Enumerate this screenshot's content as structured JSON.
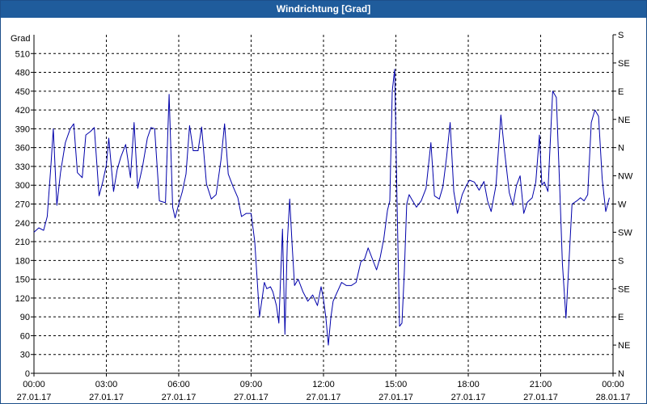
{
  "window": {
    "title": "Windrichtung [Grad]"
  },
  "chart_data": {
    "type": "line",
    "title": "Windrichtung [Grad]",
    "ylabel": "Grad",
    "ylim": [
      0,
      540
    ],
    "yticks": [
      0,
      30,
      60,
      90,
      120,
      150,
      180,
      210,
      240,
      270,
      300,
      330,
      360,
      390,
      420,
      450,
      480,
      510
    ],
    "xlim_hours": [
      0,
      24
    ],
    "xticks": [
      {
        "time": "00:00",
        "date": "27.01.17",
        "hour": 0
      },
      {
        "time": "03:00",
        "date": "27.01.17",
        "hour": 3
      },
      {
        "time": "06:00",
        "date": "27.01.17",
        "hour": 6
      },
      {
        "time": "09:00",
        "date": "27.01.17",
        "hour": 9
      },
      {
        "time": "12:00",
        "date": "27.01.17",
        "hour": 12
      },
      {
        "time": "15:00",
        "date": "27.01.17",
        "hour": 15
      },
      {
        "time": "18:00",
        "date": "27.01.17",
        "hour": 18
      },
      {
        "time": "21:00",
        "date": "27.01.17",
        "hour": 21
      },
      {
        "time": "00:00",
        "date": "28.01.17",
        "hour": 24
      }
    ],
    "y2_labels": [
      {
        "label": "N",
        "value": 0
      },
      {
        "label": "NE",
        "value": 45
      },
      {
        "label": "E",
        "value": 90
      },
      {
        "label": "SE",
        "value": 135
      },
      {
        "label": "S",
        "value": 180
      },
      {
        "label": "SW",
        "value": 225
      },
      {
        "label": "W",
        "value": 270
      },
      {
        "label": "NW",
        "value": 315
      },
      {
        "label": "N",
        "value": 360
      },
      {
        "label": "NE",
        "value": 405
      },
      {
        "label": "E",
        "value": 450
      },
      {
        "label": "SE",
        "value": 495
      },
      {
        "label": "S",
        "value": 540
      }
    ],
    "grid": true,
    "line_color": "#0000aa",
    "series": [
      {
        "x_hours": [
          0.0,
          0.2,
          0.4,
          0.55,
          0.7,
          0.8,
          0.95,
          1.1,
          1.3,
          1.5,
          1.65,
          1.8,
          2.0,
          2.15,
          2.35,
          2.5,
          2.7,
          2.85,
          3.0,
          3.1,
          3.3,
          3.45,
          3.6,
          3.8,
          4.0,
          4.15,
          4.3,
          4.5,
          4.7,
          4.85,
          5.0,
          5.2,
          5.45,
          5.6,
          5.75,
          5.85,
          6.0,
          6.15,
          6.3,
          6.45,
          6.6,
          6.8,
          6.95,
          7.15,
          7.35,
          7.55,
          7.75,
          7.9,
          8.05,
          8.25,
          8.45,
          8.6,
          8.8,
          9.0,
          9.15,
          9.35,
          9.55,
          9.65,
          9.8,
          9.9,
          10.05,
          10.15,
          10.3,
          10.4,
          10.5,
          10.6,
          10.7,
          10.8,
          10.95,
          11.15,
          11.35,
          11.55,
          11.75,
          11.9,
          12.0,
          12.1,
          12.2,
          12.3,
          12.4,
          12.55,
          12.75,
          12.95,
          13.15,
          13.35,
          13.55,
          13.7,
          13.85,
          14.0,
          14.2,
          14.35,
          14.5,
          14.65,
          14.75,
          14.85,
          14.95,
          15.05,
          15.15,
          15.25,
          15.35,
          15.45,
          15.55,
          15.65,
          15.85,
          16.05,
          16.25,
          16.45,
          16.6,
          16.8,
          16.95,
          17.1,
          17.25,
          17.4,
          17.55,
          17.75,
          17.9,
          18.05,
          18.25,
          18.45,
          18.65,
          18.8,
          18.95,
          19.15,
          19.35,
          19.5,
          19.7,
          19.85,
          20.0,
          20.15,
          20.3,
          20.45,
          20.65,
          20.8,
          20.95,
          21.05,
          21.15,
          21.3,
          21.5,
          21.65,
          21.8,
          21.9,
          22.05,
          22.3,
          22.5,
          22.65,
          22.8,
          22.95,
          23.1,
          23.25,
          23.4,
          23.55,
          23.7,
          23.85,
          24.0
        ],
        "values": [
          225,
          232,
          228,
          250,
          330,
          390,
          268,
          320,
          368,
          390,
          398,
          320,
          312,
          380,
          386,
          392,
          283,
          305,
          332,
          375,
          290,
          325,
          345,
          365,
          312,
          400,
          295,
          330,
          375,
          392,
          390,
          275,
          272,
          445,
          265,
          248,
          270,
          290,
          318,
          395,
          355,
          355,
          393,
          302,
          278,
          285,
          340,
          398,
          318,
          298,
          280,
          250,
          255,
          255,
          210,
          90,
          145,
          135,
          138,
          130,
          108,
          80,
          230,
          62,
          210,
          278,
          205,
          140,
          150,
          130,
          115,
          125,
          108,
          138,
          118,
          88,
          45,
          88,
          115,
          128,
          145,
          140,
          140,
          145,
          178,
          182,
          200,
          185,
          165,
          185,
          215,
          260,
          275,
          450,
          485,
          270,
          75,
          80,
          160,
          270,
          285,
          278,
          265,
          275,
          295,
          368,
          283,
          278,
          298,
          345,
          400,
          290,
          255,
          285,
          298,
          308,
          305,
          292,
          306,
          275,
          258,
          300,
          412,
          355,
          288,
          268,
          300,
          315,
          255,
          273,
          280,
          305,
          380,
          300,
          305,
          290,
          450,
          440,
          285,
          175,
          88,
          270,
          275,
          280,
          275,
          285,
          400,
          420,
          410,
          310,
          258,
          280
        ]
      }
    ]
  }
}
